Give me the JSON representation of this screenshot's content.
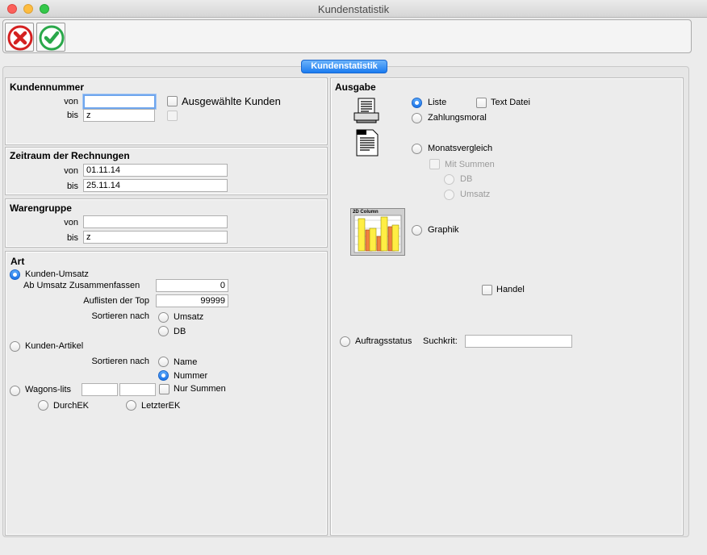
{
  "window": {
    "title": "Kundenstatistik"
  },
  "toolbar": {
    "cancel_icon": "red-x-circle-icon",
    "ok_icon": "green-check-circle-icon"
  },
  "tab": {
    "label": "Kundenstatistik"
  },
  "kundennummer": {
    "title": "Kundennummer",
    "von_label": "von",
    "von_value": "",
    "bis_label": "bis",
    "bis_value": "z",
    "ausgewaehlt_label": "Ausgewählte Kunden"
  },
  "zeitraum": {
    "title": "Zeitraum der Rechnungen",
    "von_label": "von",
    "von_value": "01.11.14",
    "bis_label": "bis",
    "bis_value": "25.11.14"
  },
  "warengruppe": {
    "title": "Warengruppe",
    "von_label": "von",
    "von_value": "",
    "bis_label": "bis",
    "bis_value": "z"
  },
  "art": {
    "title": "Art",
    "kunden_umsatz": "Kunden-Umsatz",
    "zusammenfassen_label": "Ab Umsatz Zusammenfassen",
    "zusammenfassen_value": "0",
    "top_label": "Auflisten der Top",
    "top_value": "99999",
    "sortieren1_label": "Sortieren nach",
    "umsatz": "Umsatz",
    "db": "DB",
    "kunden_artikel": "Kunden-Artikel",
    "sortieren2_label": "Sortieren nach",
    "name": "Name",
    "nummer": "Nummer",
    "wagons_lits": "Wagons-lits",
    "wagons_val1": "",
    "wagons_val2": "",
    "nur_summen": "Nur Summen",
    "durchek": "DurchEK",
    "letzterek": "LetzterEK"
  },
  "ausgabe": {
    "title": "Ausgabe",
    "liste": "Liste",
    "text_datei": "Text Datei",
    "zahlungsmoral": "Zahlungsmoral",
    "monatsvergleich": "Monatsvergleich",
    "mit_summen": "Mit Summen",
    "db": "DB",
    "umsatz": "Umsatz",
    "chart_label": "2D Column",
    "graphik": "Graphik",
    "handel": "Handel",
    "auftragsstatus": "Auftragsstatus",
    "suchkrit_label": "Suchkrit:",
    "suchkrit_value": ""
  },
  "colors": {
    "accent": "#1c7cf0",
    "cancel": "#e03030",
    "ok": "#2aa84a"
  }
}
